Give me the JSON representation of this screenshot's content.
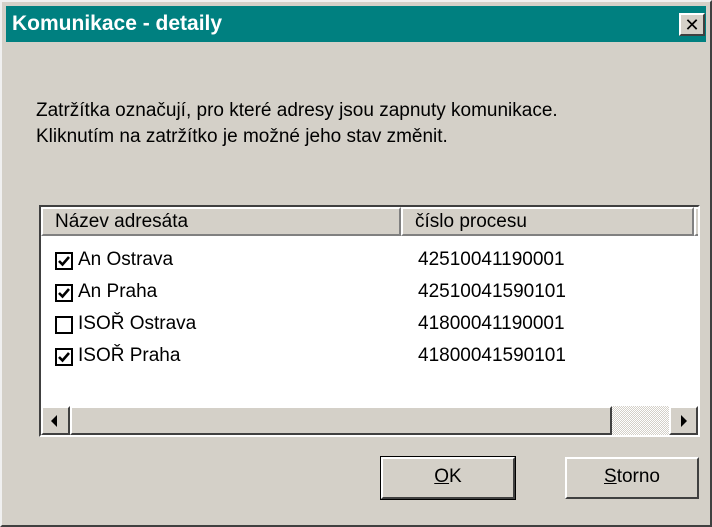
{
  "window": {
    "title": "Komunikace - detaily",
    "close_icon": "close-icon"
  },
  "description": {
    "line1": "Zatržítka označují, pro které adresy jsou zapnuty komunikace.",
    "line2": "Kliknutím na zatržítko je možné jeho stav změnit."
  },
  "list": {
    "columns": [
      "Název adresáta",
      "číslo procesu"
    ],
    "rows": [
      {
        "checked": true,
        "name": "An Ostrava",
        "process": "42510041190001"
      },
      {
        "checked": true,
        "name": "An Praha",
        "process": "42510041590101"
      },
      {
        "checked": false,
        "name": "ISOŘ Ostrava",
        "process": "41800041190001"
      },
      {
        "checked": true,
        "name": "ISOŘ Praha",
        "process": "41800041590101"
      }
    ]
  },
  "buttons": {
    "ok_label": "OK",
    "ok_accel": "O",
    "ok_rest": "K",
    "storno_label": "Storno",
    "storno_accel": "S",
    "storno_rest": "torno"
  },
  "colors": {
    "title_bar": "#008080",
    "face": "#d4d0c8"
  }
}
